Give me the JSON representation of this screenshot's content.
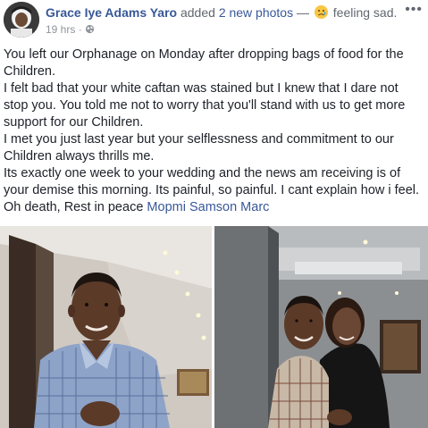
{
  "header": {
    "author": "Grace Iye Adams Yaro",
    "action_prefix": "added",
    "photos_link": "2 new photos",
    "separator": "—",
    "feeling": "feeling sad.",
    "emoji_icon": "sad-face-emoji",
    "time": "19 hrs",
    "dot": "·",
    "privacy_icon": "globe-icon",
    "more_label": "•••"
  },
  "post": {
    "paragraphs": [
      "You left our Orphanage on Monday after dropping bags of food for the Children.",
      "I felt bad that your white caftan was stained but I knew that I dare not stop you. You told me not to worry that you'll stand with us to get more support for our Children.",
      "I met you just last year but your selflessness and commitment to our Children always thrills me.",
      "Its exactly one week to your wedding and the news am receiving is of your demise this morning. Its painful, so painful. I cant explain how i feel. Oh death, Rest in peace"
    ],
    "mention": "Mopmi Samson Marc"
  },
  "photos": {
    "count": 2
  }
}
